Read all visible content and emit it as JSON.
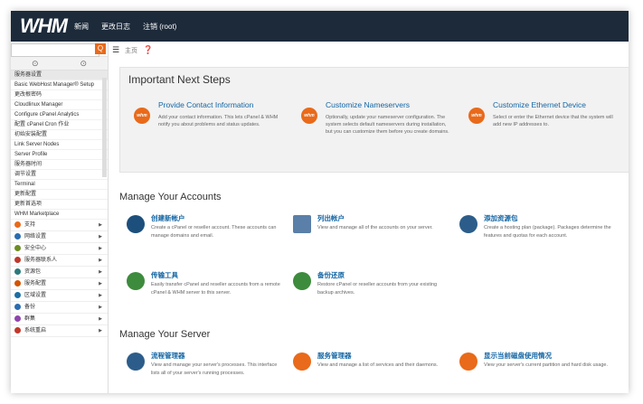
{
  "header": {
    "logo": "WHM",
    "nav": [
      "新闻",
      "更改日志",
      "注销 (root)"
    ]
  },
  "sidebar": {
    "search_placeholder": "",
    "search_button": "Q",
    "toggles": [
      "⊙",
      "⊙"
    ],
    "items": [
      "服务器设置",
      "Basic WebHost Manager® Setup",
      "更改根密码",
      "Cloudlinux Manager",
      "Configure cPanel Analytics",
      "配置 cPanel Cron 作业",
      "初始安装配置",
      "Link Server Nodes",
      "Server Profile",
      "服务器时间",
      "调节设置",
      "Terminal",
      "更新配置",
      "更新首选项",
      "WHM Marketplace"
    ],
    "categories": [
      {
        "label": "支持",
        "color": "#e96a1a"
      },
      {
        "label": "网络设置",
        "color": "#2b6cb0"
      },
      {
        "label": "安全中心",
        "color": "#6b8e23"
      },
      {
        "label": "服务器联系人",
        "color": "#c0392b"
      },
      {
        "label": "资源包",
        "color": "#2c7a7b"
      },
      {
        "label": "服务配置",
        "color": "#d35400"
      },
      {
        "label": "区域设置",
        "color": "#1c6ea4"
      },
      {
        "label": "备份",
        "color": "#2b6cb0"
      },
      {
        "label": "群集",
        "color": "#8e44ad"
      },
      {
        "label": "系统重启",
        "color": "#c0392b"
      }
    ]
  },
  "toolbar": {
    "list_icon": "list-icon",
    "grid_label": "主页",
    "help_icon": "help-icon"
  },
  "important": {
    "title": "Important Next Steps",
    "steps": [
      {
        "title": "Provide Contact Information",
        "desc": "Add your contact information. This lets cPanel & WHM notify you about problems and status updates."
      },
      {
        "title": "Customize Nameservers",
        "desc": "Optionally, update your nameserver configuration. The system selects default nameservers during installation, but you can customize them before you create domains."
      },
      {
        "title": "Customize Ethernet Device",
        "desc": "Select or enter the Ethernet device that the system will add new IP addresses to."
      }
    ]
  },
  "accounts": {
    "title": "Manage Your Accounts",
    "tiles": [
      {
        "title": "创建新帐户",
        "desc": "Create a cPanel or reseller account. These accounts can manage domains and email."
      },
      {
        "title": "列出帐户",
        "desc": "View and manage all of the accounts on your server."
      },
      {
        "title": "添加资源包",
        "desc": "Create a hosting plan (package). Packages determine the features and quotas for each account."
      },
      {
        "title": "传输工具",
        "desc": "Easily transfer cPanel and reseller accounts from a remote cPanel & WHM server to this server."
      },
      {
        "title": "备份还原",
        "desc": "Restore cPanel or reseller accounts from your existing backup archives."
      }
    ]
  },
  "server": {
    "title": "Manage Your Server",
    "tiles": [
      {
        "title": "流程管理器",
        "desc": "View and manage your server's processes. This interface lists all of your server's running processes."
      },
      {
        "title": "服务管理器",
        "desc": "View and manage a list of services and their daemons."
      },
      {
        "title": "显示当前磁盘使用情况",
        "desc": "View your server's current partition and hard disk usage."
      }
    ]
  },
  "colors": {
    "topbar": "#1c2a3a",
    "accent": "#e96a1a",
    "link": "#1466a4"
  }
}
